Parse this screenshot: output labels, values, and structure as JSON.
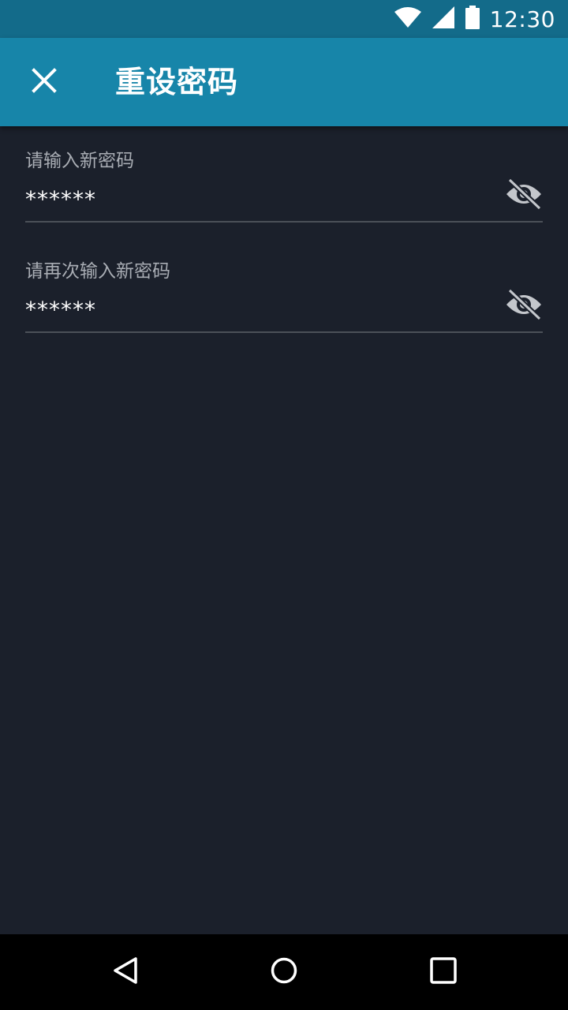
{
  "status_bar": {
    "time": "12:30",
    "icons": [
      "wifi-icon",
      "signal-icon",
      "battery-icon"
    ]
  },
  "app_bar": {
    "title": "重设密码",
    "close_icon": "close-icon",
    "background_color": "#1785a9"
  },
  "form": {
    "fields": [
      {
        "label": "请输入新密码",
        "value": "******",
        "toggle_icon": "visibility-off-icon"
      },
      {
        "label": "请再次输入新密码",
        "value": "******",
        "toggle_icon": "visibility-off-icon"
      }
    ]
  },
  "nav_bar": {
    "buttons": [
      "back-icon",
      "home-icon",
      "recents-icon"
    ]
  },
  "colors": {
    "status_bar": "#136b8a",
    "app_bar": "#1785a9",
    "background": "#1b202b",
    "label": "#a9adb4",
    "underline": "#4b5058",
    "icon": "#c4c7cc"
  }
}
